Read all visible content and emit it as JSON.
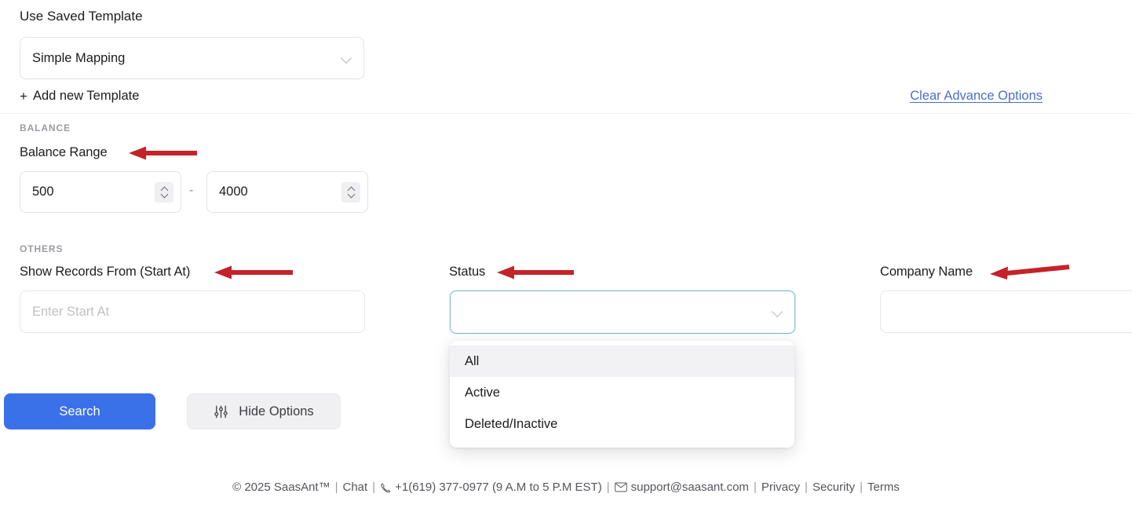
{
  "saved_template": {
    "title": "Use Saved Template",
    "selected": "Simple Mapping",
    "add_new_label": "Add new Template",
    "plus": "+",
    "chevron_icon": "chevron-down-icon"
  },
  "clear_advance_options": "Clear Advance Options",
  "balance": {
    "section_label": "BALANCE",
    "range_label": "Balance Range",
    "min_value": "500",
    "max_value": "4000",
    "separator": "-"
  },
  "others": {
    "section_label": "OTHERS",
    "start_at": {
      "label": "Show Records From (Start At)",
      "value": "",
      "placeholder": "Enter Start At"
    },
    "status": {
      "label": "Status",
      "value": "",
      "options": [
        "All",
        "Active",
        "Deleted/Inactive"
      ],
      "highlighted_option": "All"
    },
    "company_name": {
      "label": "Company Name",
      "value": "",
      "placeholder": ""
    }
  },
  "actions": {
    "search_label": "Search",
    "hide_options_label": "Hide Options",
    "hide_options_icon": "sliders-icon"
  },
  "footer": {
    "copyright": "© 2025 SaasAnt™",
    "chat": "Chat",
    "phone": "+1(619) 377-0977 (9 A.M to 5 P.M EST)",
    "phone_icon": "phone-icon",
    "email": "support@saasant.com",
    "email_icon": "envelope-icon",
    "privacy": "Privacy",
    "security": "Security",
    "terms": "Terms",
    "separator": "|"
  },
  "annotations": {
    "arrow_color": "#c32329",
    "arrows": [
      {
        "name": "arrow-balance-range",
        "points_to": "Balance Range"
      },
      {
        "name": "arrow-show-records-from",
        "points_to": "Show Records From (Start At)"
      },
      {
        "name": "arrow-status",
        "points_to": "Status"
      },
      {
        "name": "arrow-company-name",
        "points_to": "Company Name"
      }
    ]
  },
  "colors": {
    "primary_button": "#3b71e8",
    "link": "#4a6fc9",
    "focus_border": "#7fb6d9",
    "annotation_red": "#c32329"
  }
}
